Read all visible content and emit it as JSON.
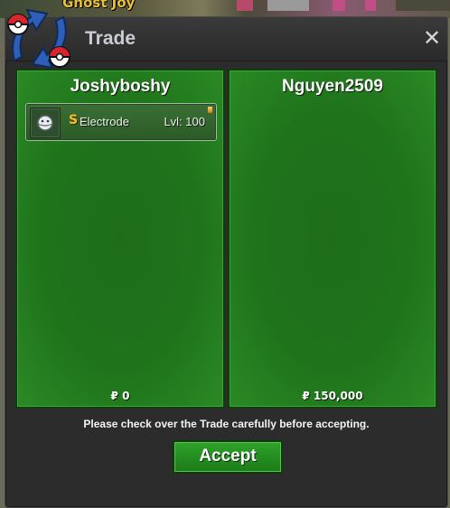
{
  "background": {
    "overhead_name": "Ghost Joy"
  },
  "window": {
    "title": "Trade",
    "close_icon": "close-x-icon",
    "logo_icon": "trade-swap-pokeball-icon"
  },
  "traders": [
    {
      "name": "Joshyboshy",
      "items": [
        {
          "icon": "electrode-sprite-icon",
          "shiny_marker": "S",
          "name": "Electrode",
          "level": "Lvl: 100"
        }
      ],
      "money": "₽ 0"
    },
    {
      "name": "Nguyen2509",
      "items": [],
      "money": "₽ 150,000"
    }
  ],
  "notice": "Please check over the Trade carefully before accepting.",
  "accept_label": "Accept",
  "colors": {
    "panel_green": "#1f741b",
    "accept_green": "#2fa32a",
    "title_color": "#c9ccd3",
    "shiny_gold": "#f2c02a",
    "name_gold": "#e8c13a"
  }
}
